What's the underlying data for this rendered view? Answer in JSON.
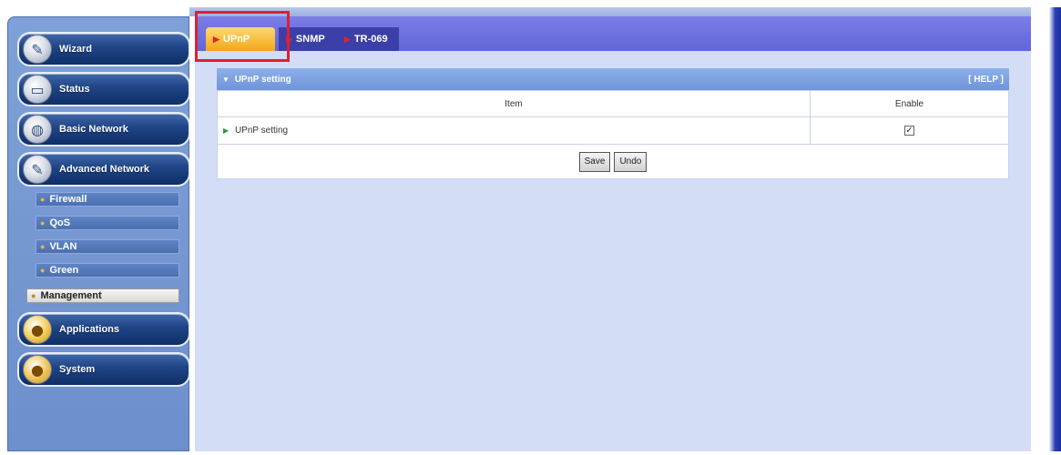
{
  "sidebar": {
    "menu": [
      {
        "label": "Wizard",
        "icon": "wrench-icon"
      },
      {
        "label": "Status",
        "icon": "monitor-icon"
      },
      {
        "label": "Basic Network",
        "icon": "globe-icon"
      },
      {
        "label": "Advanced Network",
        "icon": "wrench-icon"
      }
    ],
    "submenu": [
      {
        "label": "Firewall"
      },
      {
        "label": "QoS"
      },
      {
        "label": "VLAN"
      },
      {
        "label": "Green"
      },
      {
        "label": "Management",
        "active": true
      }
    ],
    "menu_bottom": [
      {
        "label": "Applications",
        "icon": "applications-icon"
      },
      {
        "label": "System",
        "icon": "system-icon"
      }
    ]
  },
  "tabs": [
    {
      "label": "UPnP",
      "active": true
    },
    {
      "label": "SNMP"
    },
    {
      "label": "TR-069"
    }
  ],
  "panel": {
    "title": "UPnP setting",
    "help": "[ HELP ]",
    "columns": {
      "item": "Item",
      "enable": "Enable"
    },
    "rows": [
      {
        "item": "UPnP setting",
        "enabled": true
      }
    ],
    "buttons": {
      "save": "Save",
      "undo": "Undo"
    }
  },
  "colors": {
    "accent": "#6166d8",
    "active_tab": "#f2a818",
    "highlight": "#e0202a"
  }
}
